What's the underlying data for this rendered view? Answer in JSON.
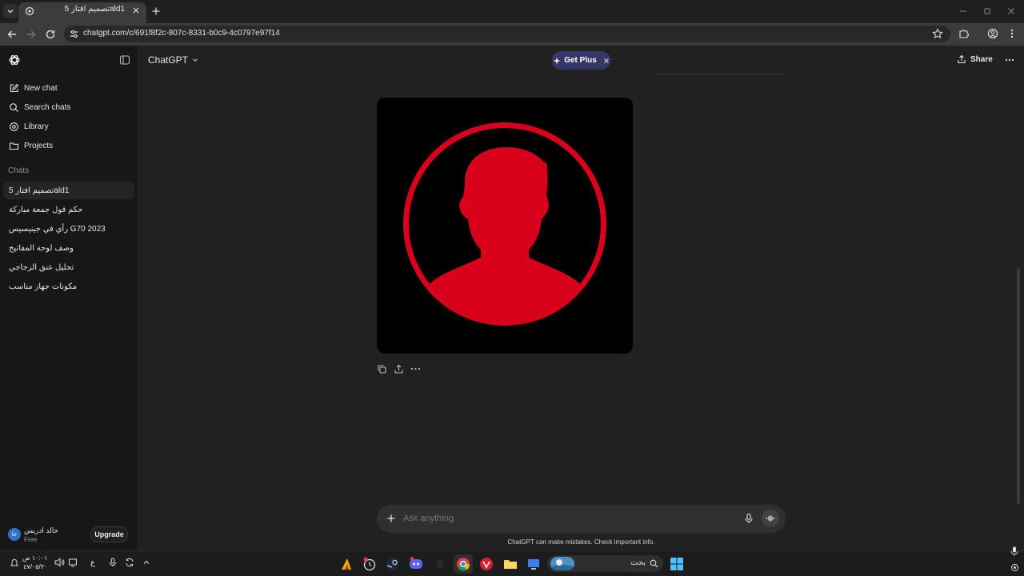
{
  "browser": {
    "tab_title": "تصميم افتار 5ald1",
    "url": "chatgpt.com/c/691f8f2c-807c-8331-b0c9-4c0797e97f14"
  },
  "header": {
    "model_label": "ChatGPT",
    "get_plus_label": "Get Plus",
    "share_label": "Share"
  },
  "sidebar": {
    "items": [
      {
        "label": "New chat",
        "icon": "edit-icon"
      },
      {
        "label": "Search chats",
        "icon": "search-icon"
      },
      {
        "label": "Library",
        "icon": "library-icon"
      },
      {
        "label": "Projects",
        "icon": "folder-icon"
      }
    ],
    "section_label": "Chats",
    "chats": [
      "تصميم افتار 5ald1",
      "حكم قول جمعة مباركة",
      "رأي في جينيسيس G70 2023",
      "وصف لوحة المفاتيح",
      "تحليل عنق الزجاجي",
      "مكونات جهاز مناسب"
    ],
    "user": {
      "avatar_initials": "خا",
      "name": "خالد ادريس",
      "plan": "Free",
      "upgrade_label": "Upgrade"
    }
  },
  "composer": {
    "placeholder": "Ask anything",
    "disclaimer": "ChatGPT can make mistakes. Check important info."
  },
  "taskbar": {
    "time": "١٠:٠١ ص",
    "date": "٤٧/٠٥/٣٠",
    "lang": "ع",
    "search_placeholder": "بحث"
  },
  "colors": {
    "accent_red": "#d9001b",
    "plus_bg": "#373669"
  }
}
